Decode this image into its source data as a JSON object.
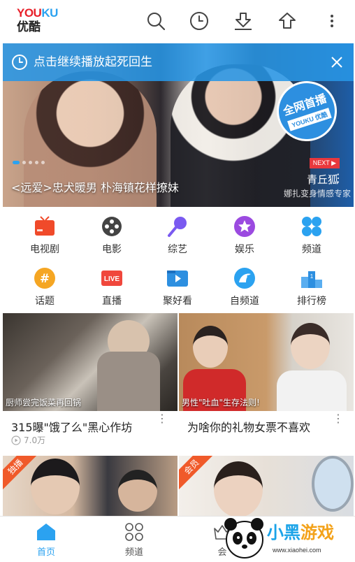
{
  "header": {
    "logo_en_part1": "YOU",
    "logo_en_part2": "KU",
    "logo_cn": "优酷",
    "icons": [
      "search-icon",
      "history-icon",
      "download-icon",
      "upload-icon",
      "more-icon"
    ]
  },
  "hero": {
    "resume_text": "点击继续播放起死回生",
    "caption": "<远爱>忠犬暖男 朴海镇花样撩妹",
    "badge_top": "全网首播",
    "badge_sub": "YOUKU 优酷",
    "next_tag": "NEXT",
    "next_title": "青丘狐",
    "next_subtitle": "娜扎变身情感专家"
  },
  "categories": [
    {
      "label": "电视剧",
      "icon": "tv-icon",
      "color": "#f04a2a"
    },
    {
      "label": "电影",
      "icon": "film-reel-icon",
      "color": "#444444"
    },
    {
      "label": "综艺",
      "icon": "microphone-icon",
      "color": "#7a5af0"
    },
    {
      "label": "娱乐",
      "icon": "star-icon",
      "color": "#9b4ae0"
    },
    {
      "label": "频道",
      "icon": "channels-icon",
      "color": "#2ba2f0"
    },
    {
      "label": "话题",
      "icon": "hashtag-icon",
      "color": "#f5a623"
    },
    {
      "label": "直播",
      "icon": "live-icon",
      "color": "#f0473c"
    },
    {
      "label": "聚好看",
      "icon": "play-folder-icon",
      "color": "#2d8fe0"
    },
    {
      "label": "自频道",
      "icon": "bird-icon",
      "color": "#2ba2f0"
    },
    {
      "label": "排行榜",
      "icon": "podium-icon",
      "color": "#2d8fe0"
    }
  ],
  "cards": [
    {
      "caption": "厨师尝完饭菜再回锅",
      "title": "315曝\"饿了么\"黑心作坊",
      "views": "7.0万",
      "corner": ""
    },
    {
      "caption": "男性\"吐血\"生存法则!",
      "title": "为啥你的礼物女票不喜欢",
      "views": "",
      "corner": ""
    },
    {
      "caption": "",
      "title": "",
      "views": "",
      "corner": "独播"
    },
    {
      "caption": "",
      "title": "",
      "views": "",
      "corner": "会员"
    }
  ],
  "bottom_nav": [
    {
      "label": "首页",
      "icon": "home-icon",
      "active": true
    },
    {
      "label": "频道",
      "icon": "grid-icon",
      "active": false
    },
    {
      "label": "会",
      "icon": "member-icon",
      "active": false
    }
  ],
  "watermark": {
    "text_part1": "小黑",
    "text_part2": "游戏",
    "url": "www.xiaohei.com"
  },
  "colors": {
    "accent": "#2ba2f0",
    "resume_bar": "#2896e6",
    "brand_red": "#e8202a"
  }
}
